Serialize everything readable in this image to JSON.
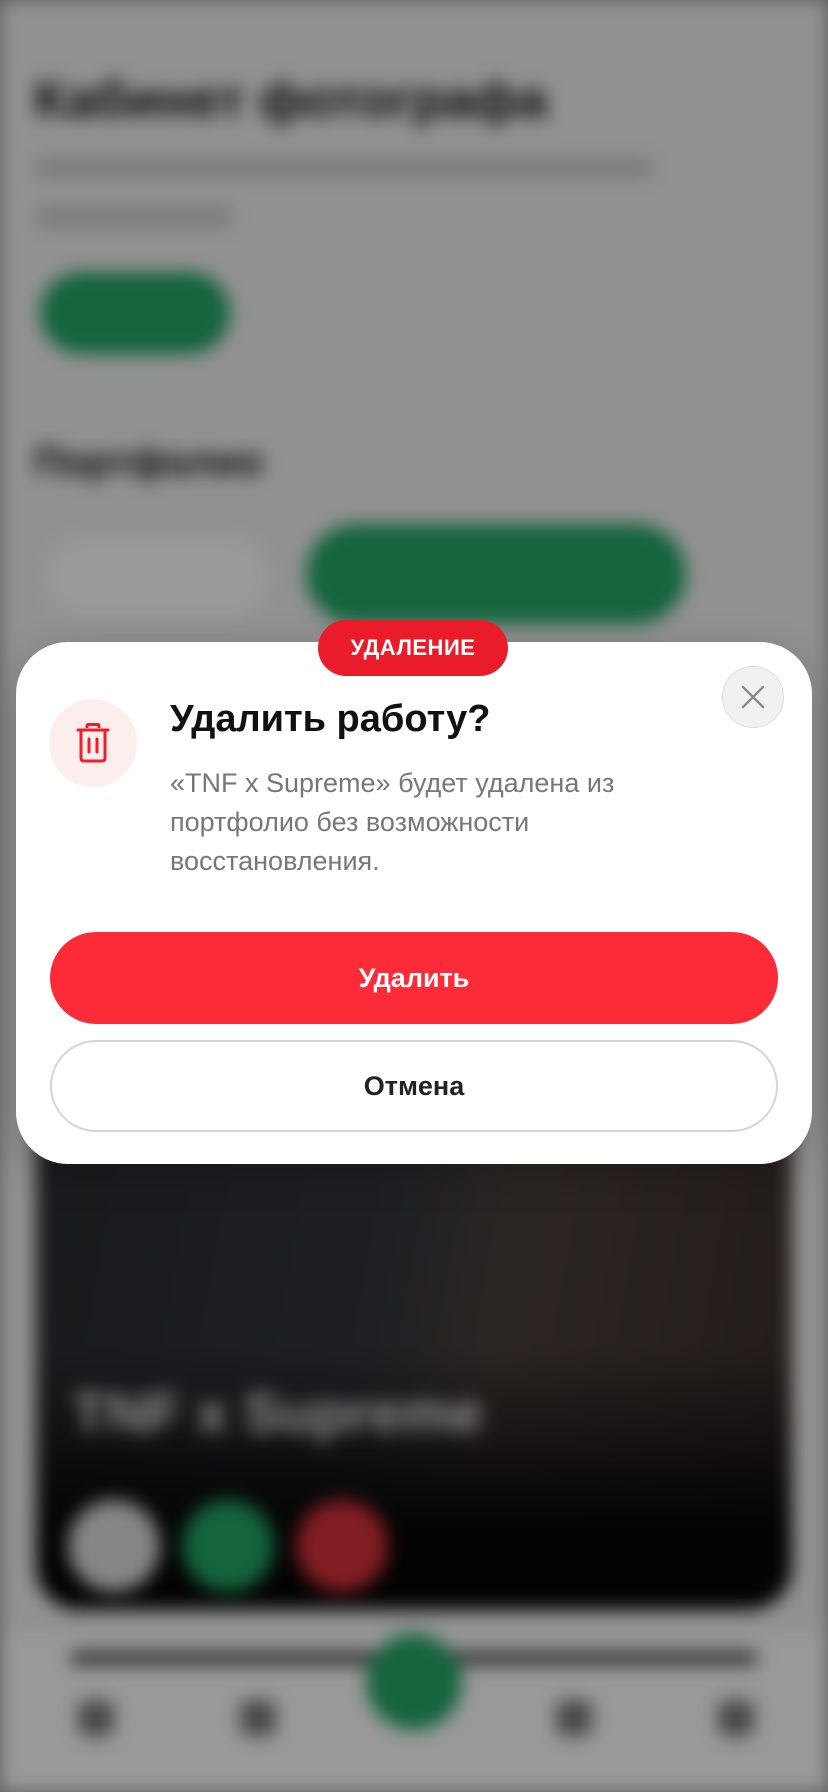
{
  "background": {
    "page_title": "Кабинет фотографа",
    "section_title": "Портфолио",
    "card_title": "TNF x Supreme"
  },
  "colors": {
    "accent_green": "#22a766",
    "danger_red": "#fd2b37",
    "tag_red": "#ea1c2c"
  },
  "modal": {
    "tag": "УДАЛЕНИЕ",
    "title": "Удалить работу?",
    "body": "«TNF x Supreme» будет удалена из портфолио без возможности восстановления.",
    "icon": "trash-icon",
    "close_icon": "close-icon",
    "delete_label": "Удалить",
    "cancel_label": "Отмена"
  }
}
